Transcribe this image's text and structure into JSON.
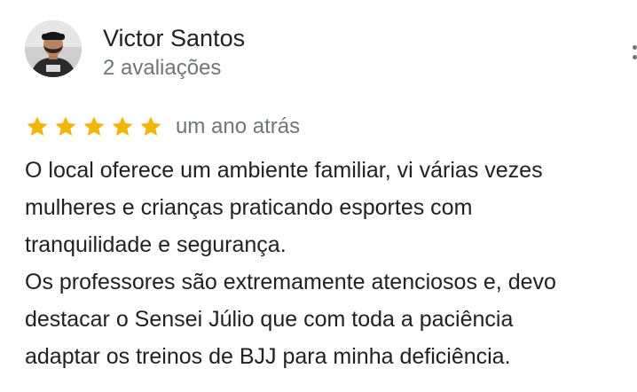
{
  "review": {
    "reviewer_name": "Victor Santos",
    "review_count": "2 avaliações",
    "rating": 5,
    "rating_max": 5,
    "date": "um ano atrás",
    "text_lines": [
      "O local oferece um ambiente familiar, vi várias vezes",
      "mulheres e crianças praticando esportes com",
      "tranquilidade e segurança.",
      "Os professores são extremamente atenciosos e, devo",
      "destacar o Sensei Júlio que com toda a paciência",
      "adaptar os treinos de BJJ para minha deficiência."
    ]
  },
  "icons": {
    "star": "star-icon",
    "menu": "more-vertical-icon",
    "avatar": "user-photo"
  },
  "colors": {
    "star": "#f5b400",
    "text": "#202124",
    "secondary_text": "#70757a"
  }
}
